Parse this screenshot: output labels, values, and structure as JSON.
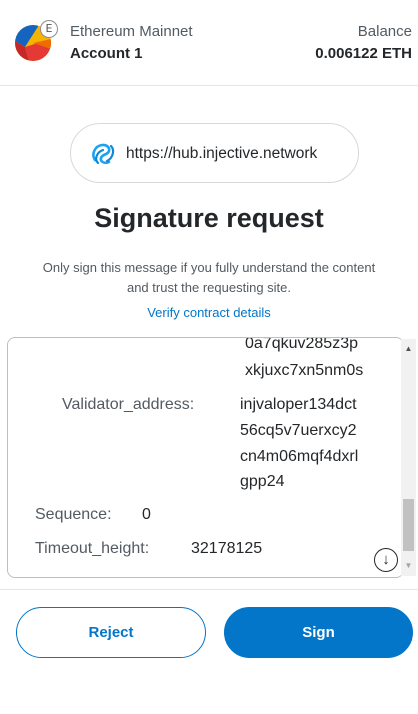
{
  "header": {
    "network_name": "Ethereum Mainnet",
    "network_badge": "E",
    "account_name": "Account 1",
    "balance_label": "Balance",
    "balance_value": "0.006122 ETH"
  },
  "origin": {
    "url": "https://hub.injective.network",
    "icon": "injective-logo-icon"
  },
  "title": "Signature request",
  "subtitle": "Only sign this message if you fully understand the content and trust the requesting site.",
  "verify_link": "Verify contract details",
  "message": {
    "overflow_line_1": "0a7qkuv285z3p",
    "overflow_line_2": "xkjuxc7xn5nm0s",
    "validator_label": "Validator_address:",
    "validator_lines": [
      "injvaloper134dct",
      "56cq5v7uerxcy2",
      "cn4m06mqf4dxrl",
      "gpp24"
    ],
    "sequence_label": "Sequence:",
    "sequence_value": "0",
    "timeout_label": "Timeout_height:",
    "timeout_value": "32178125"
  },
  "scroll_down_icon": "arrow-down-icon",
  "actions": {
    "reject": "Reject",
    "sign": "Sign"
  },
  "colors": {
    "primary": "#0376c9",
    "text": "#24272a",
    "muted": "#535a61",
    "border": "#bbc0c5"
  }
}
